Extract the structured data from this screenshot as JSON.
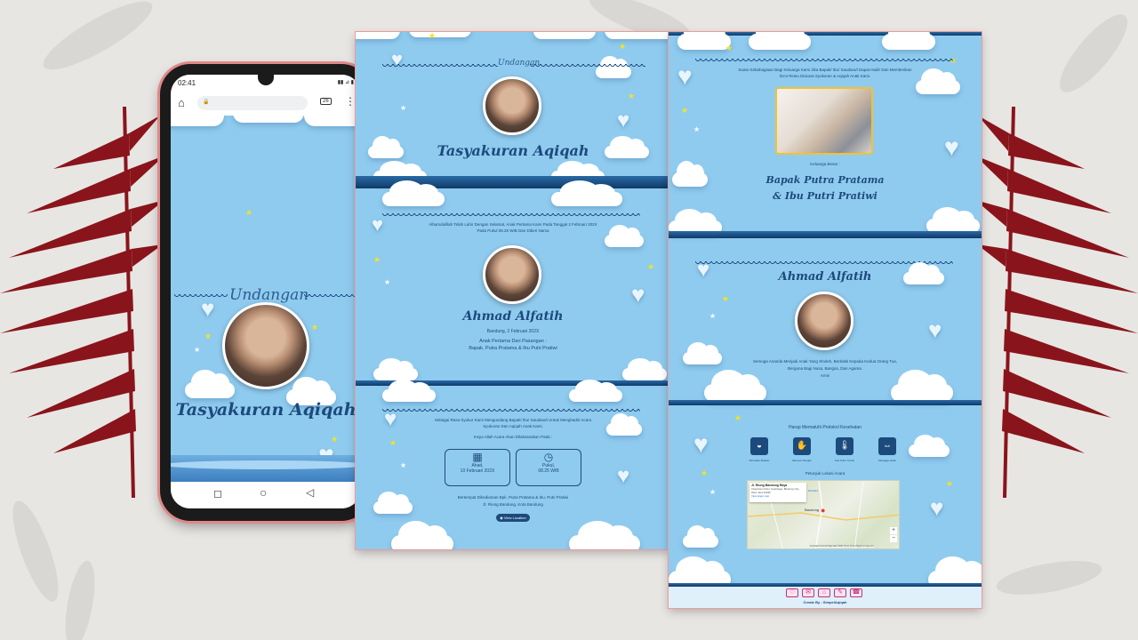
{
  "phone": {
    "status_time": "02:41",
    "status_icons": "▮▮ ⊿ ▮",
    "tab_count": "26",
    "undangan": "Undangan",
    "title": "Tasyakuran Aqiqah",
    "nav": {
      "square": "◻",
      "circle": "○",
      "back": "◁"
    },
    "icons": {
      "home": "⌂",
      "lock": "🔒",
      "menu": "⋮"
    }
  },
  "panel1": {
    "undangan": "Undangan",
    "title": "Tasyakuran Aqiqah",
    "intro": "Alhamdulillah Telah Lahir Dengan Selamat, Anak Pertama Kami Pada Tanggal 2 Februari 202X",
    "intro2": "Pada Pukul 08.25 WIB Dan Diberi Nama",
    "child_name": "Ahmad Alfatih",
    "birth_place_date": "Bandung, 2 Februari 202X",
    "child_of": "Anak Pertama Dari Pasangan :",
    "parents": "Bapak. Putra Pratama & Ibu Putri Pratiwi",
    "gratitude": "Sebagai Rasa Syukur Kami Mengundang Bapak/ Ibu/ Saudara/i Untuk Menghadiri Acara",
    "gratitude2": "Syukuran Dan Aqiqah Anak Kami.",
    "insya": "Insya Allah Acara Akan Dilaksanakan Pada :",
    "date_label": "Ahad,",
    "date_value": "10 Februari 202X",
    "time_label": "Pukul,",
    "time_value": "08.25 WIB",
    "location1": "Bertempat Dikediaman Bpk. Putra Pratama & Ibu. Putri Pratiwi",
    "location2": "Jl. Riung Bandung, Kota Bandung",
    "view_location": "View Location",
    "icons": {
      "calendar": "▦",
      "clock": "◷",
      "pin": "◉"
    }
  },
  "panel2": {
    "opening": "Suatu Kebahagiaan Bagi Keluarga Kami Jika Bapak/ Ibu/ Saudara/i Dapat Hadir Dan Memberikan",
    "opening2": "Do'a Restu Diacara Syukuran & Aqiqah Anak Kami.",
    "family_label": "Keluarga Besar :",
    "family_names1": "Bapak Putra Pratama",
    "family_names2": "& Ibu Putri Pratiwi",
    "child_name": "Ahmad Alfatih",
    "prayer1": "Semoga Ananda Menjadi Anak Yang Sholeh, Berbakti Kepada Kedua Orang Tua,",
    "prayer2": "Berguna Bagi Nusa, Bangsa, Dan Agama.",
    "amin": "Amin",
    "protocol_title": "Harap Mematuhi Protokol Kesehatan",
    "protocols": [
      {
        "icon": "◒",
        "label": "Memakai Masker"
      },
      {
        "icon": "✋",
        "label": "Mencuci Tangan"
      },
      {
        "icon": "🌡",
        "label": "Cek Suhu Tubuh"
      },
      {
        "icon": "⇔",
        "label": "Menjaga Jarak"
      }
    ],
    "map_title": "Petunjuk Lokasi Acara",
    "map_place": "Jl. Riung Bandung Raya",
    "map_address": "Cisaranten Kidul, Gedebage, Bandung City, West Java 40295",
    "map_link": "View larger map",
    "map_city": "Bandung",
    "map_directions": "Directions",
    "map_zoom_in": "+",
    "map_zoom_out": "−",
    "map_footer": "Keyboard shortcuts  Map data ©2022  Terms of Use  Report a map error",
    "social": [
      "♡",
      "✉",
      "⌂",
      "✎",
      "☎"
    ],
    "credit": "Create By : SimpelAqiqah"
  }
}
